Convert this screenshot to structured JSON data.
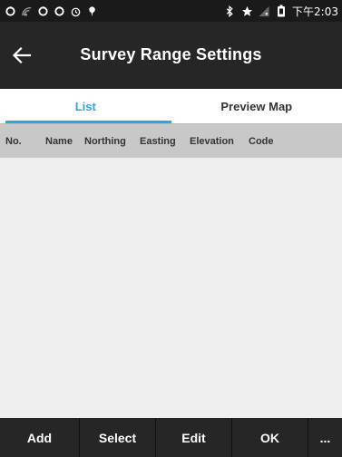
{
  "status_bar": {
    "left_icons": [
      "sync-icon",
      "signal-icon",
      "sync-icon",
      "sync-icon",
      "alarm-icon",
      "location-pin-icon"
    ],
    "right_icons": [
      "bluetooth-icon",
      "star-icon",
      "network-icon",
      "battery-icon"
    ],
    "time": "下午2:03"
  },
  "header": {
    "title": "Survey Range Settings",
    "back_icon": "back-arrow-icon"
  },
  "tabs": [
    {
      "label": "List",
      "active": true
    },
    {
      "label": "Preview Map",
      "active": false
    }
  ],
  "colors": {
    "accent": "#29a8e0",
    "bar_background": "#262626",
    "table_header_background": "#c8c8c8",
    "body_background": "#efefef"
  },
  "table": {
    "columns": [
      "No.",
      "Name",
      "Northing",
      "Easting",
      "Elevation",
      "Code"
    ],
    "rows": []
  },
  "toolbar": {
    "buttons": [
      "Add",
      "Select",
      "Edit",
      "OK",
      "..."
    ]
  }
}
